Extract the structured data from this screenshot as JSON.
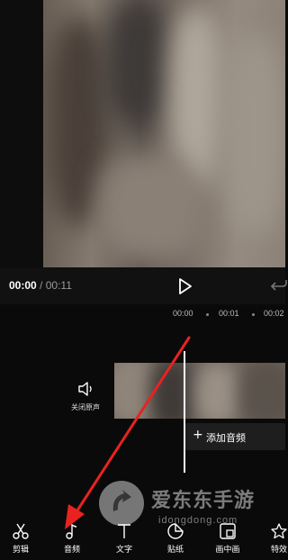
{
  "player": {
    "current_time": "00:00",
    "separator": "/",
    "total_time": "00:11"
  },
  "ruler": {
    "ticks": [
      "00:00",
      "00:01",
      "00:02"
    ]
  },
  "timeline": {
    "mute_label": "关闭原声",
    "add_audio_plus": "+",
    "add_audio_label": "添加音频"
  },
  "toolbar": {
    "items": [
      {
        "label": "剪辑",
        "icon": "scissors-icon"
      },
      {
        "label": "音频",
        "icon": "music-note-icon"
      },
      {
        "label": "文字",
        "icon": "text-icon"
      },
      {
        "label": "贴纸",
        "icon": "sticker-icon"
      },
      {
        "label": "画中画",
        "icon": "picture-in-picture-icon"
      },
      {
        "label": "特效",
        "icon": "star-effect-icon"
      }
    ]
  },
  "watermark": {
    "title": "爱东东手游",
    "subtitle": "idongdong.com"
  },
  "annotation": {
    "arrow_color": "#e8231f"
  }
}
